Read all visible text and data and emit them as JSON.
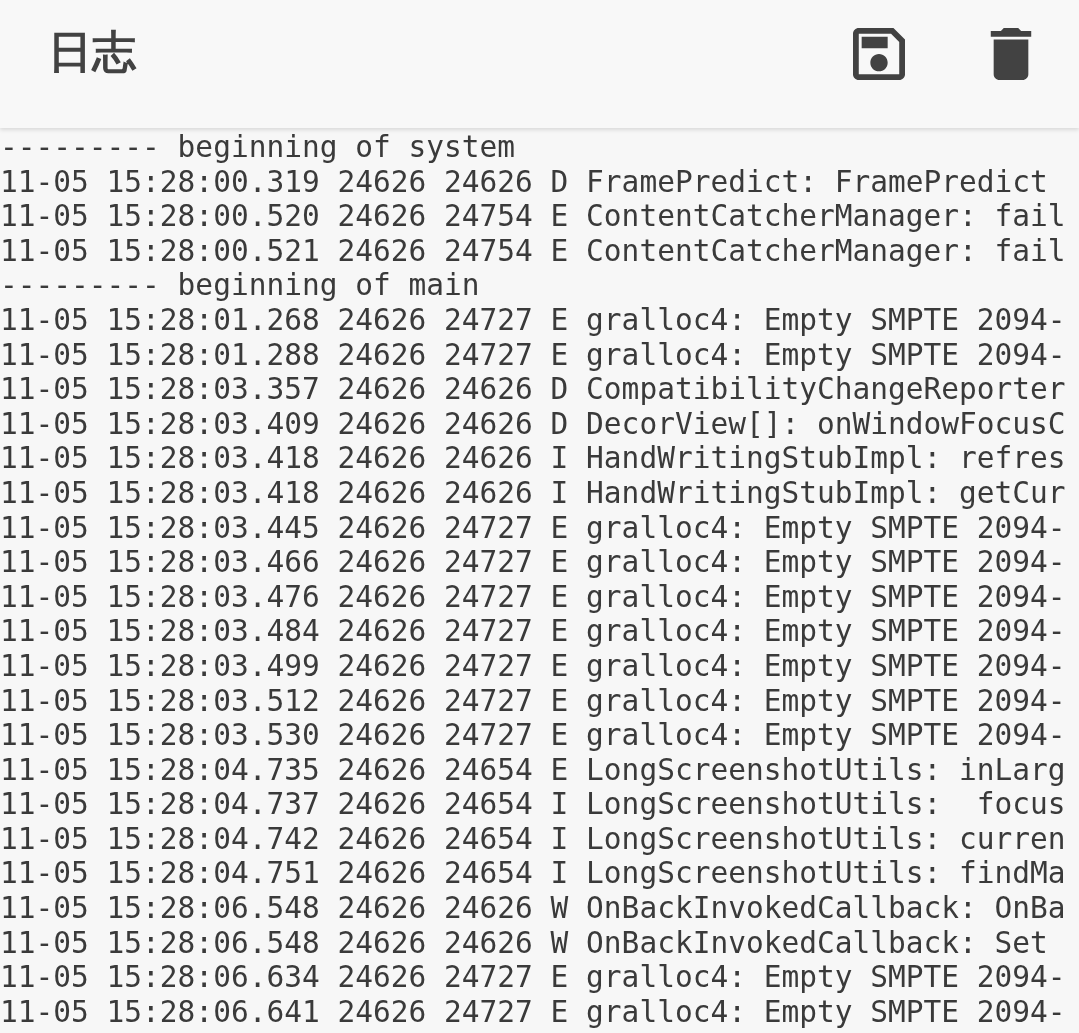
{
  "app_bar": {
    "title": "日志",
    "actions": [
      {
        "kind": "save"
      },
      {
        "kind": "delete"
      }
    ]
  },
  "log_lines": [
    "--------- beginning of system",
    "11-05 15:28:00.319 24626 24626 D FramePredict: FramePredict",
    "11-05 15:28:00.520 24626 24754 E ContentCatcherManager: fail",
    "11-05 15:28:00.521 24626 24754 E ContentCatcherManager: fail",
    "--------- beginning of main",
    "11-05 15:28:01.268 24626 24727 E gralloc4: Empty SMPTE 2094-",
    "11-05 15:28:01.288 24626 24727 E gralloc4: Empty SMPTE 2094-",
    "11-05 15:28:03.357 24626 24626 D CompatibilityChangeReporter",
    "11-05 15:28:03.409 24626 24626 D DecorView[]: onWindowFocusC",
    "11-05 15:28:03.418 24626 24626 I HandWritingStubImpl: refres",
    "11-05 15:28:03.418 24626 24626 I HandWritingStubImpl: getCur",
    "11-05 15:28:03.445 24626 24727 E gralloc4: Empty SMPTE 2094-",
    "11-05 15:28:03.466 24626 24727 E gralloc4: Empty SMPTE 2094-",
    "11-05 15:28:03.476 24626 24727 E gralloc4: Empty SMPTE 2094-",
    "11-05 15:28:03.484 24626 24727 E gralloc4: Empty SMPTE 2094-",
    "11-05 15:28:03.499 24626 24727 E gralloc4: Empty SMPTE 2094-",
    "11-05 15:28:03.512 24626 24727 E gralloc4: Empty SMPTE 2094-",
    "11-05 15:28:03.530 24626 24727 E gralloc4: Empty SMPTE 2094-",
    "11-05 15:28:04.735 24626 24654 E LongScreenshotUtils: inLarg",
    "11-05 15:28:04.737 24626 24654 I LongScreenshotUtils:  focus",
    "11-05 15:28:04.742 24626 24654 I LongScreenshotUtils: curren",
    "11-05 15:28:04.751 24626 24654 I LongScreenshotUtils: findMa",
    "11-05 15:28:06.548 24626 24626 W OnBackInvokedCallback: OnBa",
    "11-05 15:28:06.548 24626 24626 W OnBackInvokedCallback: Set",
    "11-05 15:28:06.634 24626 24727 E gralloc4: Empty SMPTE 2094-",
    "11-05 15:28:06.641 24626 24727 E gralloc4: Empty SMPTE 2094-"
  ]
}
